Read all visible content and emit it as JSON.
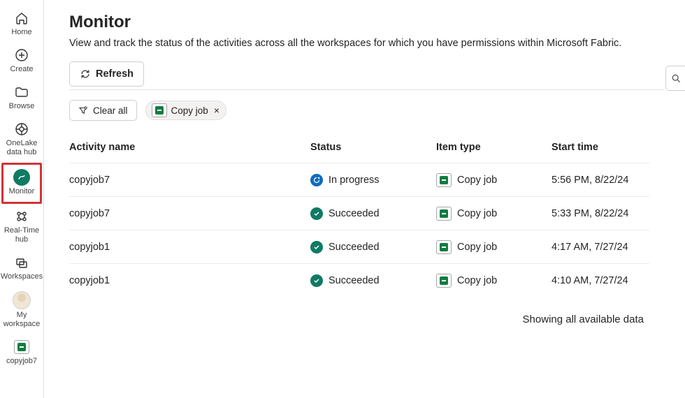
{
  "sidebar": {
    "items": [
      {
        "label": "Home",
        "icon": "home-icon"
      },
      {
        "label": "Create",
        "icon": "plus-circle-icon"
      },
      {
        "label": "Browse",
        "icon": "folder-icon"
      },
      {
        "label": "OneLake data hub",
        "icon": "data-hub-icon"
      },
      {
        "label": "Monitor",
        "icon": "monitor-icon",
        "highlighted": true
      },
      {
        "label": "Real-Time hub",
        "icon": "realtime-icon"
      },
      {
        "label": "Workspaces",
        "icon": "workspaces-icon"
      },
      {
        "label": "My workspace",
        "icon": "avatar"
      },
      {
        "label": "copyjob7",
        "icon": "copyjob-icon"
      }
    ]
  },
  "header": {
    "title": "Monitor",
    "subtitle": "View and track the status of the activities across all the workspaces for which you have permissions within Microsoft Fabric."
  },
  "toolbar": {
    "refresh_label": "Refresh",
    "clear_all_label": "Clear all",
    "filter_chip": {
      "label": "Copy job"
    }
  },
  "table": {
    "columns": {
      "activity_name": "Activity name",
      "status": "Status",
      "item_type": "Item type",
      "start_time": "Start time"
    },
    "rows": [
      {
        "activity_name": "copyjob7",
        "status": "In progress",
        "status_kind": "in-progress",
        "item_type": "Copy job",
        "start_time": "5:56 PM, 8/22/24"
      },
      {
        "activity_name": "copyjob7",
        "status": "Succeeded",
        "status_kind": "succeeded",
        "item_type": "Copy job",
        "start_time": "5:33 PM, 8/22/24"
      },
      {
        "activity_name": "copyjob1",
        "status": "Succeeded",
        "status_kind": "succeeded",
        "item_type": "Copy job",
        "start_time": "4:17 AM, 7/27/24"
      },
      {
        "activity_name": "copyjob1",
        "status": "Succeeded",
        "status_kind": "succeeded",
        "item_type": "Copy job",
        "start_time": "4:10 AM, 7/27/24"
      }
    ]
  },
  "footer": {
    "message": "Showing all available data"
  },
  "colors": {
    "highlight_border": "#d13438",
    "status_inprogress": "#0f6cbd",
    "status_succeeded": "#0f7b62",
    "brand_green": "#107c41"
  }
}
